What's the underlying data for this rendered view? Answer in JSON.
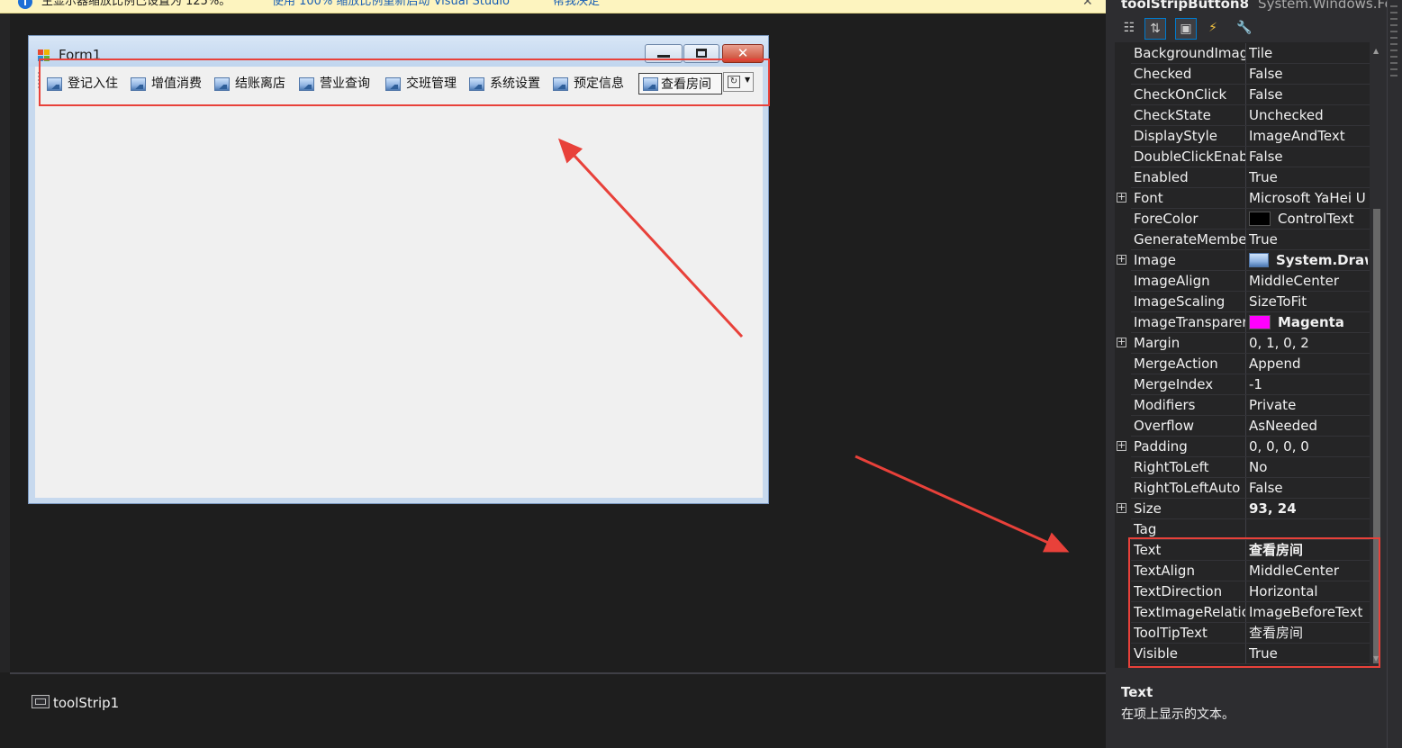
{
  "infobar": {
    "message": "主显示器缩放比例已设置为 125%。",
    "link_restart": "使用 100% 缩放比例重新启动 Visual Studio",
    "link_help": "帮我决定",
    "close_glyph": "✕",
    "info_glyph": "i"
  },
  "form": {
    "title": "Form1",
    "minimize_glyph": "",
    "maximize_glyph": "",
    "close_glyph": "✕"
  },
  "toolstrip": {
    "buttons": [
      {
        "label": "登记入住"
      },
      {
        "label": "增值消费"
      },
      {
        "label": "结账离店"
      },
      {
        "label": "营业查询"
      },
      {
        "label": "交班管理"
      },
      {
        "label": "系统设置"
      },
      {
        "label": "预定信息"
      },
      {
        "label": "查看房间"
      }
    ],
    "add_glyph": "↻",
    "add_arrow": "▼"
  },
  "tray": {
    "component": "toolStrip1"
  },
  "properties": {
    "object_name": "toolStripButton8",
    "object_type": "System.Windows.Fo",
    "rows": [
      {
        "name": "BackgroundImag",
        "value": "Tile"
      },
      {
        "name": "Checked",
        "value": "False"
      },
      {
        "name": "CheckOnClick",
        "value": "False"
      },
      {
        "name": "CheckState",
        "value": "Unchecked"
      },
      {
        "name": "DisplayStyle",
        "value": "ImageAndText"
      },
      {
        "name": "DoubleClickEnab",
        "value": "False"
      },
      {
        "name": "Enabled",
        "value": "True"
      },
      {
        "name": "Font",
        "value": "Microsoft YaHei U",
        "expandable": true
      },
      {
        "name": "ForeColor",
        "value": "ControlText",
        "swatch": "#000000"
      },
      {
        "name": "GenerateMembe",
        "value": "True"
      },
      {
        "name": "Image",
        "value": "System.Drawi",
        "expandable": true,
        "bold": true,
        "image": true
      },
      {
        "name": "ImageAlign",
        "value": "MiddleCenter"
      },
      {
        "name": "ImageScaling",
        "value": "SizeToFit"
      },
      {
        "name": "ImageTransparer",
        "value": "Magenta",
        "bold": true,
        "swatch": "#ff00ff"
      },
      {
        "name": "Margin",
        "value": "0, 1, 0, 2",
        "expandable": true
      },
      {
        "name": "MergeAction",
        "value": "Append"
      },
      {
        "name": "MergeIndex",
        "value": "-1"
      },
      {
        "name": "Modifiers",
        "value": "Private"
      },
      {
        "name": "Overflow",
        "value": "AsNeeded"
      },
      {
        "name": "Padding",
        "value": "0, 0, 0, 0",
        "expandable": true
      },
      {
        "name": "RightToLeft",
        "value": "No"
      },
      {
        "name": "RightToLeftAuto",
        "value": "False"
      },
      {
        "name": "Size",
        "value": "93, 24",
        "expandable": true,
        "bold": true
      },
      {
        "name": "Tag",
        "value": ""
      },
      {
        "name": "Text",
        "value": "查看房间",
        "bold": true
      },
      {
        "name": "TextAlign",
        "value": "MiddleCenter"
      },
      {
        "name": "TextDirection",
        "value": "Horizontal"
      },
      {
        "name": "TextImageRelatio",
        "value": "ImageBeforeText"
      },
      {
        "name": "ToolTipText",
        "value": "查看房间"
      },
      {
        "name": "Visible",
        "value": "True"
      }
    ],
    "description_title": "Text",
    "description_text": "在项上显示的文本。"
  },
  "colors": {
    "annotation": "#e8413a",
    "vs_background": "#1e1e1e",
    "form_client": "#f0f0f0"
  }
}
